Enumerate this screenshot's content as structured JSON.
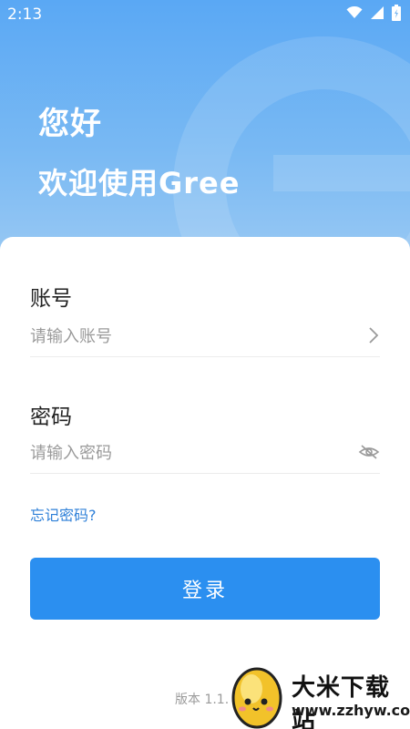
{
  "status_bar": {
    "time": "2:13",
    "icons": [
      "wifi-icon",
      "signal-icon",
      "battery-icon"
    ]
  },
  "header": {
    "greeting": "您好",
    "welcome": "欢迎使用Gree"
  },
  "form": {
    "account_label": "账号",
    "account_placeholder": "请输入账号",
    "account_value": "",
    "password_label": "密码",
    "password_placeholder": "请输入密码",
    "password_value": "",
    "forgot_password": "忘记密码?",
    "login_button": "登录"
  },
  "footer": {
    "version": "版本 1.1."
  },
  "watermark": {
    "title": "大米下载站",
    "url": "www.zzhyw.com"
  },
  "colors": {
    "accent": "#2b8ff0",
    "header_top": "#5aa8f4",
    "link": "#2f80d8"
  }
}
